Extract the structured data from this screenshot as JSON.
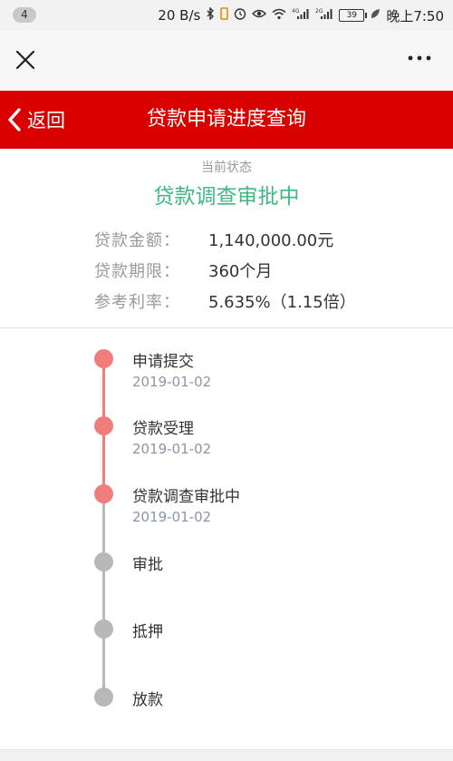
{
  "status_bar": {
    "notification_count": "4",
    "speed": "20 B/s",
    "net1": "4G",
    "net2": "2G",
    "battery": "39",
    "time": "晚上7:50"
  },
  "header": {
    "back_label": "返回",
    "title": "贷款申请进度查询"
  },
  "status": {
    "caption": "当前状态",
    "value": "贷款调查审批中",
    "value_color": "#41b883"
  },
  "info": [
    {
      "label": "贷款金额：",
      "value": "1,140,000.00元"
    },
    {
      "label": "贷款期限：",
      "value": "360个月"
    },
    {
      "label": "参考利率：",
      "value": "5.635%（1.15倍）"
    }
  ],
  "timeline": {
    "active_color": "#f07c7c",
    "inactive_color": "#b8b8b8",
    "steps": [
      {
        "title": "申请提交",
        "date": "2019-01-02",
        "done": true
      },
      {
        "title": "贷款受理",
        "date": "2019-01-02",
        "done": true
      },
      {
        "title": "贷款调查审批中",
        "date": "2019-01-02",
        "done": true
      },
      {
        "title": "审批",
        "date": "",
        "done": false
      },
      {
        "title": "抵押",
        "date": "",
        "done": false
      },
      {
        "title": "放款",
        "date": "",
        "done": false
      }
    ]
  }
}
